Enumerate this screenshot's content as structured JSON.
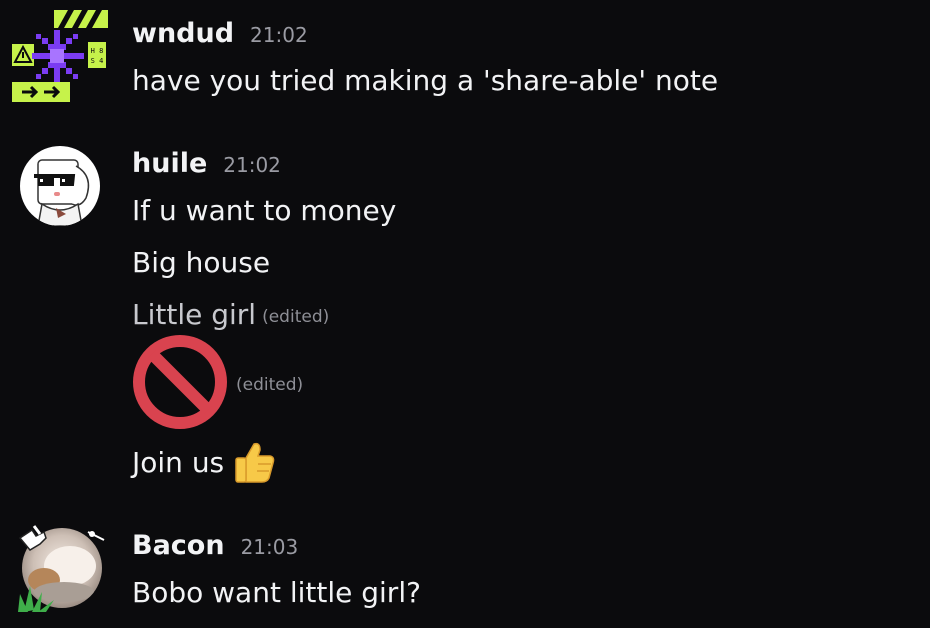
{
  "messages": [
    {
      "author": "wndud",
      "time": "21:02",
      "lines": [
        {
          "text": "have you tried making a 'share-able' note"
        }
      ]
    },
    {
      "author": "huile",
      "time": "21:02",
      "lines": [
        {
          "text": "If u want to money"
        },
        {
          "text": "Big house"
        },
        {
          "text": "Little girl",
          "edited": "(edited)"
        },
        {
          "emoji": "no-entry-sign",
          "edited": "(edited)"
        },
        {
          "text": "Join us",
          "emoji": "thumbs-up"
        }
      ]
    },
    {
      "author": "Bacon",
      "time": "21:03",
      "lines": [
        {
          "text": "Bobo want little girl?"
        }
      ]
    }
  ],
  "avatars": {
    "wndud": {
      "icon": "pixel-glitch-avatar-icon",
      "accent": "#c6f24a",
      "secondary": "#7b3cf2",
      "tag": "H 8\nS 4"
    },
    "huile": {
      "icon": "sunglasses-character-avatar-icon",
      "accent": "#ffffff"
    },
    "Bacon": {
      "icon": "cat-photo-avatar-icon",
      "decoration": "pointing-hand-and-grass"
    }
  },
  "colors": {
    "background": "#0b0b0d",
    "text": "#f2f3f5",
    "muted": "#9a9ba3",
    "no_entry_red": "#d9434f",
    "thumbs_yellow": "#f7c948"
  }
}
